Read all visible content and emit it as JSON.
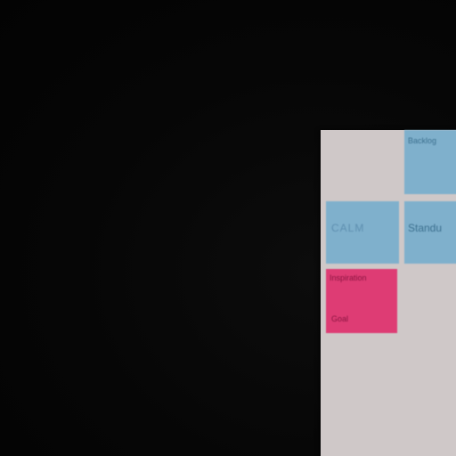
{
  "scene": {
    "description_colors": {
      "background": "#050505",
      "paper": "#cfc8c8",
      "blue_note": "#7fb0cc",
      "pink_note": "#de3c74"
    },
    "notes": [
      {
        "label": "Backlog"
      },
      {
        "label": "CALM"
      },
      {
        "label": "Standu"
      },
      {
        "label": "Inspiration"
      },
      {
        "label": "Goal"
      }
    ]
  }
}
